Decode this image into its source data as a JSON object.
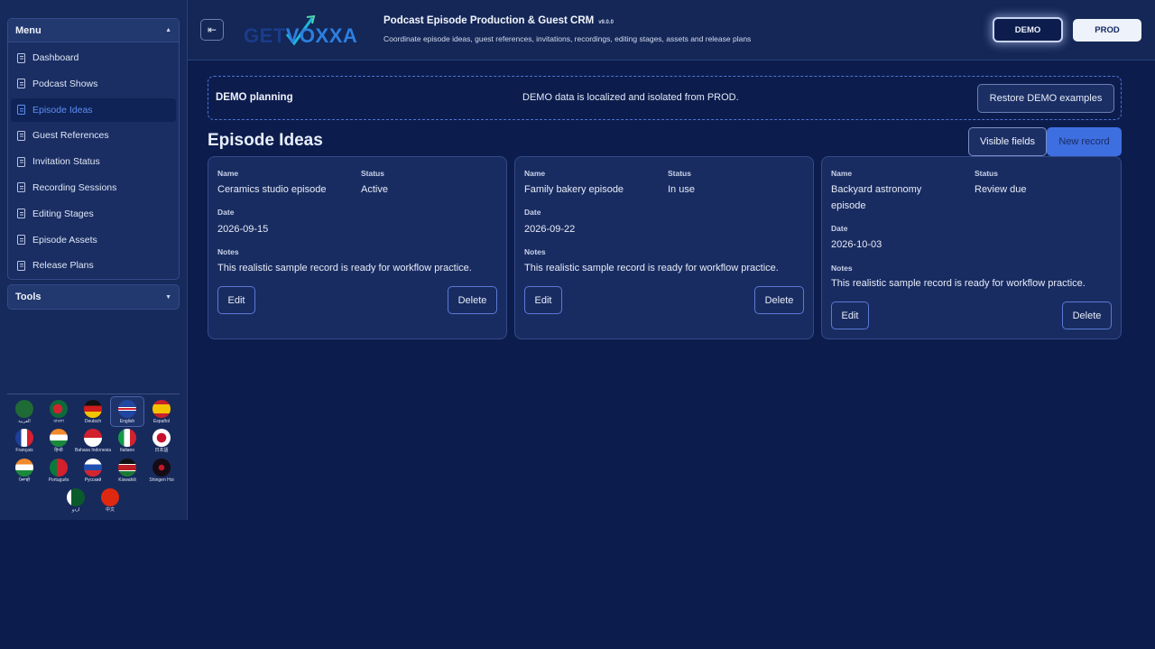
{
  "sidebar": {
    "menu_label": "Menu",
    "items": [
      {
        "label": "Dashboard",
        "active": false
      },
      {
        "label": "Podcast Shows",
        "active": false
      },
      {
        "label": "Episode Ideas",
        "active": true
      },
      {
        "label": "Guest References",
        "active": false
      },
      {
        "label": "Invitation Status",
        "active": false
      },
      {
        "label": "Recording Sessions",
        "active": false
      },
      {
        "label": "Editing Stages",
        "active": false
      },
      {
        "label": "Episode Assets",
        "active": false
      },
      {
        "label": "Release Plans",
        "active": false
      }
    ],
    "tools_label": "Tools",
    "languages": [
      {
        "label": "العربية",
        "flag": "saudi-arabia"
      },
      {
        "label": "বাংলা",
        "flag": "bangladesh"
      },
      {
        "label": "Deutsch",
        "flag": "germany"
      },
      {
        "label": "English",
        "flag": "uk",
        "selected": true
      },
      {
        "label": "Español",
        "flag": "spain"
      },
      {
        "label": "Français",
        "flag": "france"
      },
      {
        "label": "हिन्दी",
        "flag": "india"
      },
      {
        "label": "Bahasa Indonesia",
        "flag": "indonesia"
      },
      {
        "label": "Italiano",
        "flag": "italy"
      },
      {
        "label": "日本語",
        "flag": "japan"
      },
      {
        "label": "ਪੰਜਾਬੀ",
        "flag": "india"
      },
      {
        "label": "Português",
        "flag": "portugal"
      },
      {
        "label": "Русский",
        "flag": "russia"
      },
      {
        "label": "Kiswahili",
        "flag": "kenya"
      },
      {
        "label": "Shingen Hoi",
        "flag": "shingen"
      },
      {
        "label": "اردو",
        "flag": "pakistan"
      },
      {
        "label": "中文",
        "flag": "china"
      }
    ]
  },
  "header": {
    "logo_text_a": "GET",
    "logo_text_b": "V",
    "logo_text_c": "OXXA",
    "title": "Podcast Episode Production & Guest CRM",
    "version": "v9.0.0",
    "subtitle": "Coordinate episode ideas, guest references, invitations, recordings, editing stages, assets and release plans",
    "env_demo": "DEMO",
    "env_prod": "PROD"
  },
  "banner": {
    "title": "DEMO planning",
    "message": "DEMO data is localized and isolated from PROD.",
    "restore_label": "Restore DEMO examples"
  },
  "page": {
    "title": "Episode Ideas",
    "visible_fields_label": "Visible fields",
    "new_record_label": "New record"
  },
  "labels": {
    "name": "Name",
    "status": "Status",
    "date": "Date",
    "notes": "Notes",
    "edit": "Edit",
    "delete": "Delete"
  },
  "records": [
    {
      "name": "Ceramics studio episode",
      "status": "Active",
      "date": "2026-09-15",
      "notes": "This realistic sample record is ready for workflow practice."
    },
    {
      "name": "Family bakery episode",
      "status": "In use",
      "date": "2026-09-22",
      "notes": "This realistic sample record is ready for workflow practice."
    },
    {
      "name": "Backyard astronomy episode",
      "status": "Review due",
      "date": "2026-10-03",
      "notes": "This realistic sample record is ready for workflow practice."
    }
  ],
  "colors": {
    "background": "#0c1d4d",
    "sidebar": "#172a5c",
    "accent": "#3e6fe0",
    "active_text": "#5f8ff2"
  }
}
